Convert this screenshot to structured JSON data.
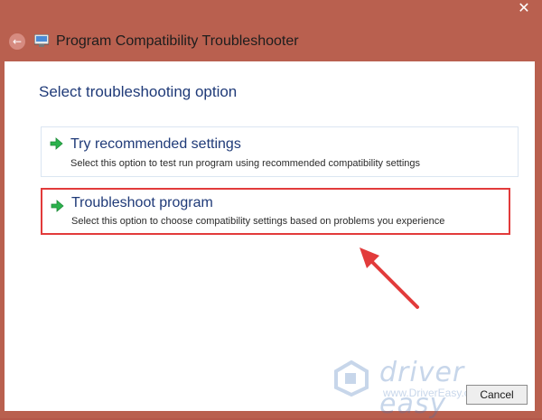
{
  "window": {
    "title": "Program Compatibility Troubleshooter",
    "close_glyph": "✕",
    "back_glyph": "←"
  },
  "main": {
    "heading": "Select troubleshooting option",
    "options": [
      {
        "title": "Try recommended settings",
        "description": "Select this option to test run program using recommended compatibility settings",
        "icon": "green-arrow-icon"
      },
      {
        "title": "Troubleshoot program",
        "description": "Select this option to choose compatibility settings based on problems you experience",
        "icon": "green-arrow-icon",
        "highlight_color": "#e23b3b"
      }
    ]
  },
  "watermark": {
    "brand": "driver easy",
    "url": "www.DriverEasy.com"
  },
  "footer": {
    "cancel_label": "Cancel"
  },
  "colors": {
    "frame": "#b9604f",
    "heading_text": "#1f3a78",
    "highlight": "#e23b3b",
    "arrow_green": "#2bb24c"
  }
}
